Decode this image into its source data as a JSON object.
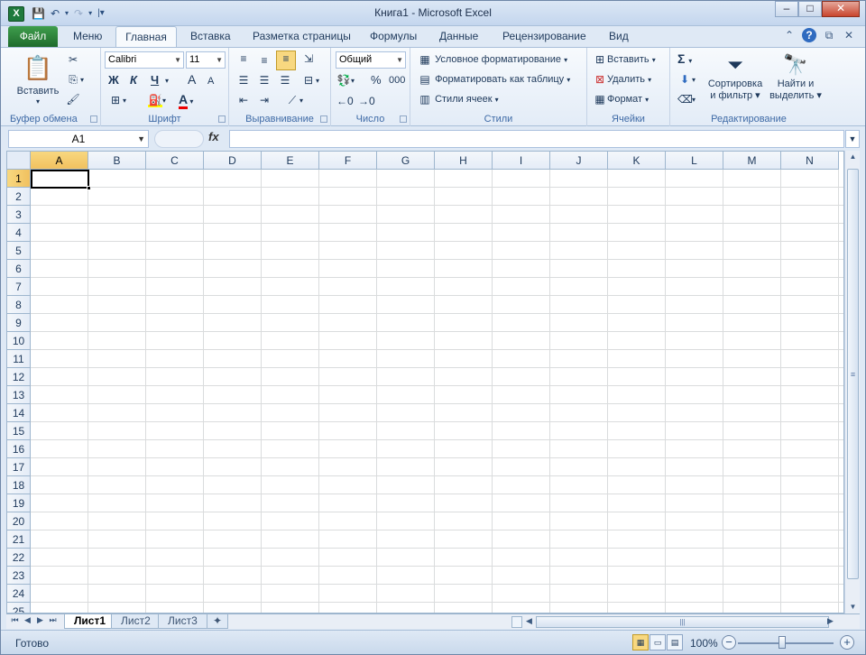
{
  "window": {
    "title": "Книга1  -  Microsoft Excel",
    "app_icon": "X",
    "qat": {
      "save": "save-icon",
      "undo": "undo-icon",
      "redo": "redo-icon",
      "customize": "customize-icon"
    }
  },
  "tabs": [
    {
      "label": "Файл"
    },
    {
      "label": "Меню"
    },
    {
      "label": "Главная"
    },
    {
      "label": "Вставка"
    },
    {
      "label": "Разметка страницы"
    },
    {
      "label": "Формулы"
    },
    {
      "label": "Данные"
    },
    {
      "label": "Рецензирование"
    },
    {
      "label": "Вид"
    }
  ],
  "ribbon": {
    "clipboard": {
      "label": "Буфер обмена",
      "paste": "Вставить"
    },
    "font": {
      "label": "Шрифт",
      "name": "Calibri",
      "size": "11",
      "bold": "Ж",
      "italic": "К",
      "underline": "Ч",
      "grow": "A",
      "shrink": "A",
      "color": "A"
    },
    "alignment": {
      "label": "Выравнивание"
    },
    "number": {
      "label": "Число",
      "format": "Общий",
      "percent": "%",
      "thousands": "000"
    },
    "styles": {
      "label": "Стили",
      "conditional": "Условное форматирование",
      "as_table": "Форматировать как таблицу",
      "cell_styles": "Стили ячеек"
    },
    "cells": {
      "label": "Ячейки",
      "insert": "Вставить",
      "delete": "Удалить",
      "format": "Формат"
    },
    "editing": {
      "label": "Редактирование",
      "sigma": "Σ",
      "sort_l1": "Сортировка",
      "sort_l2": "и фильтр",
      "find_l1": "Найти и",
      "find_l2": "выделить"
    }
  },
  "formula_bar": {
    "name_box": "A1",
    "fx": "fx",
    "value": ""
  },
  "grid": {
    "columns": [
      "A",
      "B",
      "C",
      "D",
      "E",
      "F",
      "G",
      "H",
      "I",
      "J",
      "K",
      "L",
      "M",
      "N"
    ],
    "rows": [
      "1",
      "2",
      "3",
      "4",
      "5",
      "6",
      "7",
      "8",
      "9",
      "10",
      "11",
      "12",
      "13",
      "14",
      "15",
      "16",
      "17",
      "18",
      "19",
      "20",
      "21",
      "22",
      "23",
      "24",
      "25"
    ],
    "selected_cell": "A1"
  },
  "sheets": [
    {
      "label": "Лист1",
      "active": true
    },
    {
      "label": "Лист2"
    },
    {
      "label": "Лист3"
    }
  ],
  "status": {
    "text": "Готово",
    "zoom": "100%"
  }
}
